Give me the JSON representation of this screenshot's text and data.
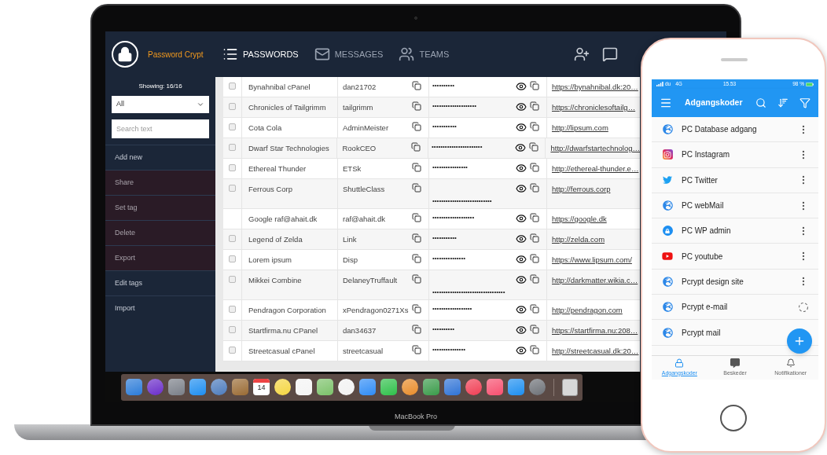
{
  "laptop": {
    "label": "MacBook Pro"
  },
  "app": {
    "brand": "Password Crypt",
    "nav": [
      {
        "label": "PASSWORDS",
        "kind": "list",
        "selected": true
      },
      {
        "label": "MESSAGES",
        "kind": "mail",
        "selected": false
      },
      {
        "label": "TEAMS",
        "kind": "users",
        "selected": false
      }
    ],
    "sidebar": {
      "showing": "Showing: 16/16",
      "filter": {
        "value": "All"
      },
      "search": {
        "placeholder": "Search text"
      },
      "items": [
        {
          "label": "Add new",
          "disabled": false
        },
        {
          "label": "Share",
          "disabled": true
        },
        {
          "label": "Set tag",
          "disabled": true
        },
        {
          "label": "Delete",
          "disabled": true
        },
        {
          "label": "Export",
          "disabled": true
        },
        {
          "label": "Edit tags",
          "disabled": false
        },
        {
          "label": "Import",
          "disabled": false
        }
      ]
    },
    "table": {
      "rows": [
        {
          "kind": "own",
          "name": "Bynahnibal cPanel",
          "user": "dan21702",
          "password": "••••••••••",
          "wrapped": false,
          "url": "https://bynahnibal.dk:20…",
          "checked": false
        },
        {
          "kind": "own",
          "name": "Chronicles of Tailgrimm",
          "user": "tailgrimm",
          "password": "••••••••••••••••••••",
          "wrapped": false,
          "url": "https://chroniclesoftailg…",
          "checked": false
        },
        {
          "kind": "own",
          "name": "Cota Cola",
          "user": "AdminMeister",
          "password": "•••••••••••",
          "wrapped": false,
          "url": "http://lipsum.com",
          "checked": false
        },
        {
          "kind": "own",
          "name": "Dwarf Star Technologies",
          "user": "RookCEO",
          "password": "•••••••••••••••••••••••",
          "wrapped": false,
          "url": "http://dwarfstartechnolog…",
          "checked": false
        },
        {
          "kind": "own",
          "name": "Ethereal Thunder",
          "user": "ETSk",
          "password": "••••••••••••••••",
          "wrapped": false,
          "url": "http://ethereal-thunder.e…",
          "checked": false
        },
        {
          "kind": "own",
          "name": "Ferrous Corp",
          "user": "ShuttleClass",
          "password": "•••••••••••••••••••••••••••",
          "wrapped": true,
          "url": "http://ferrous.corp",
          "checked": false
        },
        {
          "kind": "shared",
          "name": "Google raf@ahait.dk",
          "user": "raf@ahait.dk",
          "password": "•••••••••••••••••••",
          "wrapped": false,
          "url": "https://google.dk"
        },
        {
          "kind": "own",
          "name": "Legend of Zelda",
          "user": "Link",
          "password": "•••••••••••",
          "wrapped": false,
          "url": "http://zelda.com",
          "checked": false
        },
        {
          "kind": "own",
          "name": "Lorem ipsum",
          "user": "Disp",
          "password": "•••••••••••••••",
          "wrapped": false,
          "url": "https://www.lipsum.com/",
          "checked": false
        },
        {
          "kind": "own",
          "name": "Mikkei Combine",
          "user": "DelaneyTruffault",
          "password": "•••••••••••••••••••••••••••••••••",
          "wrapped": true,
          "url": "http://darkmatter.wikia.c…",
          "checked": false
        },
        {
          "kind": "own",
          "name": "Pendragon Corporation",
          "user": "xPendragon0271Xs",
          "password": "••••••••••••••••••",
          "wrapped": false,
          "url": "http://pendragon.com",
          "checked": false
        },
        {
          "kind": "own",
          "name": "Startfirma.nu CPanel",
          "user": "dan34637",
          "password": "••••••••••",
          "wrapped": false,
          "url": "https://startfirma.nu:208…",
          "checked": false
        },
        {
          "kind": "own",
          "name": "Streetcasual cPanel",
          "user": "streetcasual",
          "password": "•••••••••••••••",
          "wrapped": false,
          "url": "http://streetcasual.dk:20…",
          "checked": false
        }
      ]
    }
  },
  "dock": {
    "calendar_day": "14"
  },
  "phone": {
    "status_bar": {
      "carrier": "du",
      "network": "4G",
      "time": "15.53",
      "battery": "98 %"
    },
    "title": "Adgangskoder",
    "items": [
      {
        "label": "PC Database adgang",
        "kind": "globe",
        "busy": false
      },
      {
        "label": "PC Instagram",
        "kind": "instagram",
        "busy": false
      },
      {
        "label": "PC Twitter",
        "kind": "twitter",
        "busy": false
      },
      {
        "label": "PC webMail",
        "kind": "globe",
        "busy": false
      },
      {
        "label": "PC WP admin",
        "kind": "lock",
        "busy": false
      },
      {
        "label": "PC youtube",
        "kind": "youtube",
        "busy": false
      },
      {
        "label": "Pcrypt design site",
        "kind": "globe",
        "busy": false
      },
      {
        "label": "Pcrypt e-mail",
        "kind": "globe",
        "busy": true
      },
      {
        "label": "Pcrypt mail",
        "kind": "globe"
      }
    ],
    "tabs": [
      {
        "label": "Adgangskoder",
        "kind": "lock",
        "selected": true
      },
      {
        "label": "Beskeder",
        "kind": "message",
        "selected": false
      },
      {
        "label": "Notifikationer",
        "kind": "bell",
        "selected": false
      }
    ]
  }
}
